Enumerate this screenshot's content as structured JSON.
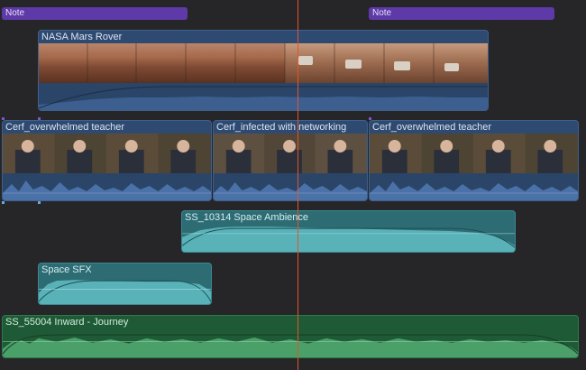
{
  "notes": [
    {
      "label": "Note"
    },
    {
      "label": "Note"
    }
  ],
  "clips": {
    "mars_rover": {
      "title": "NASA Mars Rover"
    },
    "cerf_1": {
      "title": "Cerf_overwhelmed teacher"
    },
    "cerf_2": {
      "title": "Cerf_infected with networking"
    },
    "cerf_3": {
      "title": "Cerf_overwhelmed teacher"
    },
    "space_ambience": {
      "title": "SS_10314 Space Ambience"
    },
    "space_sfx": {
      "title": "Space SFX"
    },
    "inward_journey": {
      "title": "SS_55004 Inward - Journey"
    }
  },
  "colors": {
    "note": "#5e3aa8",
    "video_clip": "#2f4a70",
    "sfx_clip": "#2e6c74",
    "music_clip": "#1f5a36",
    "playhead": "#e2552c"
  }
}
